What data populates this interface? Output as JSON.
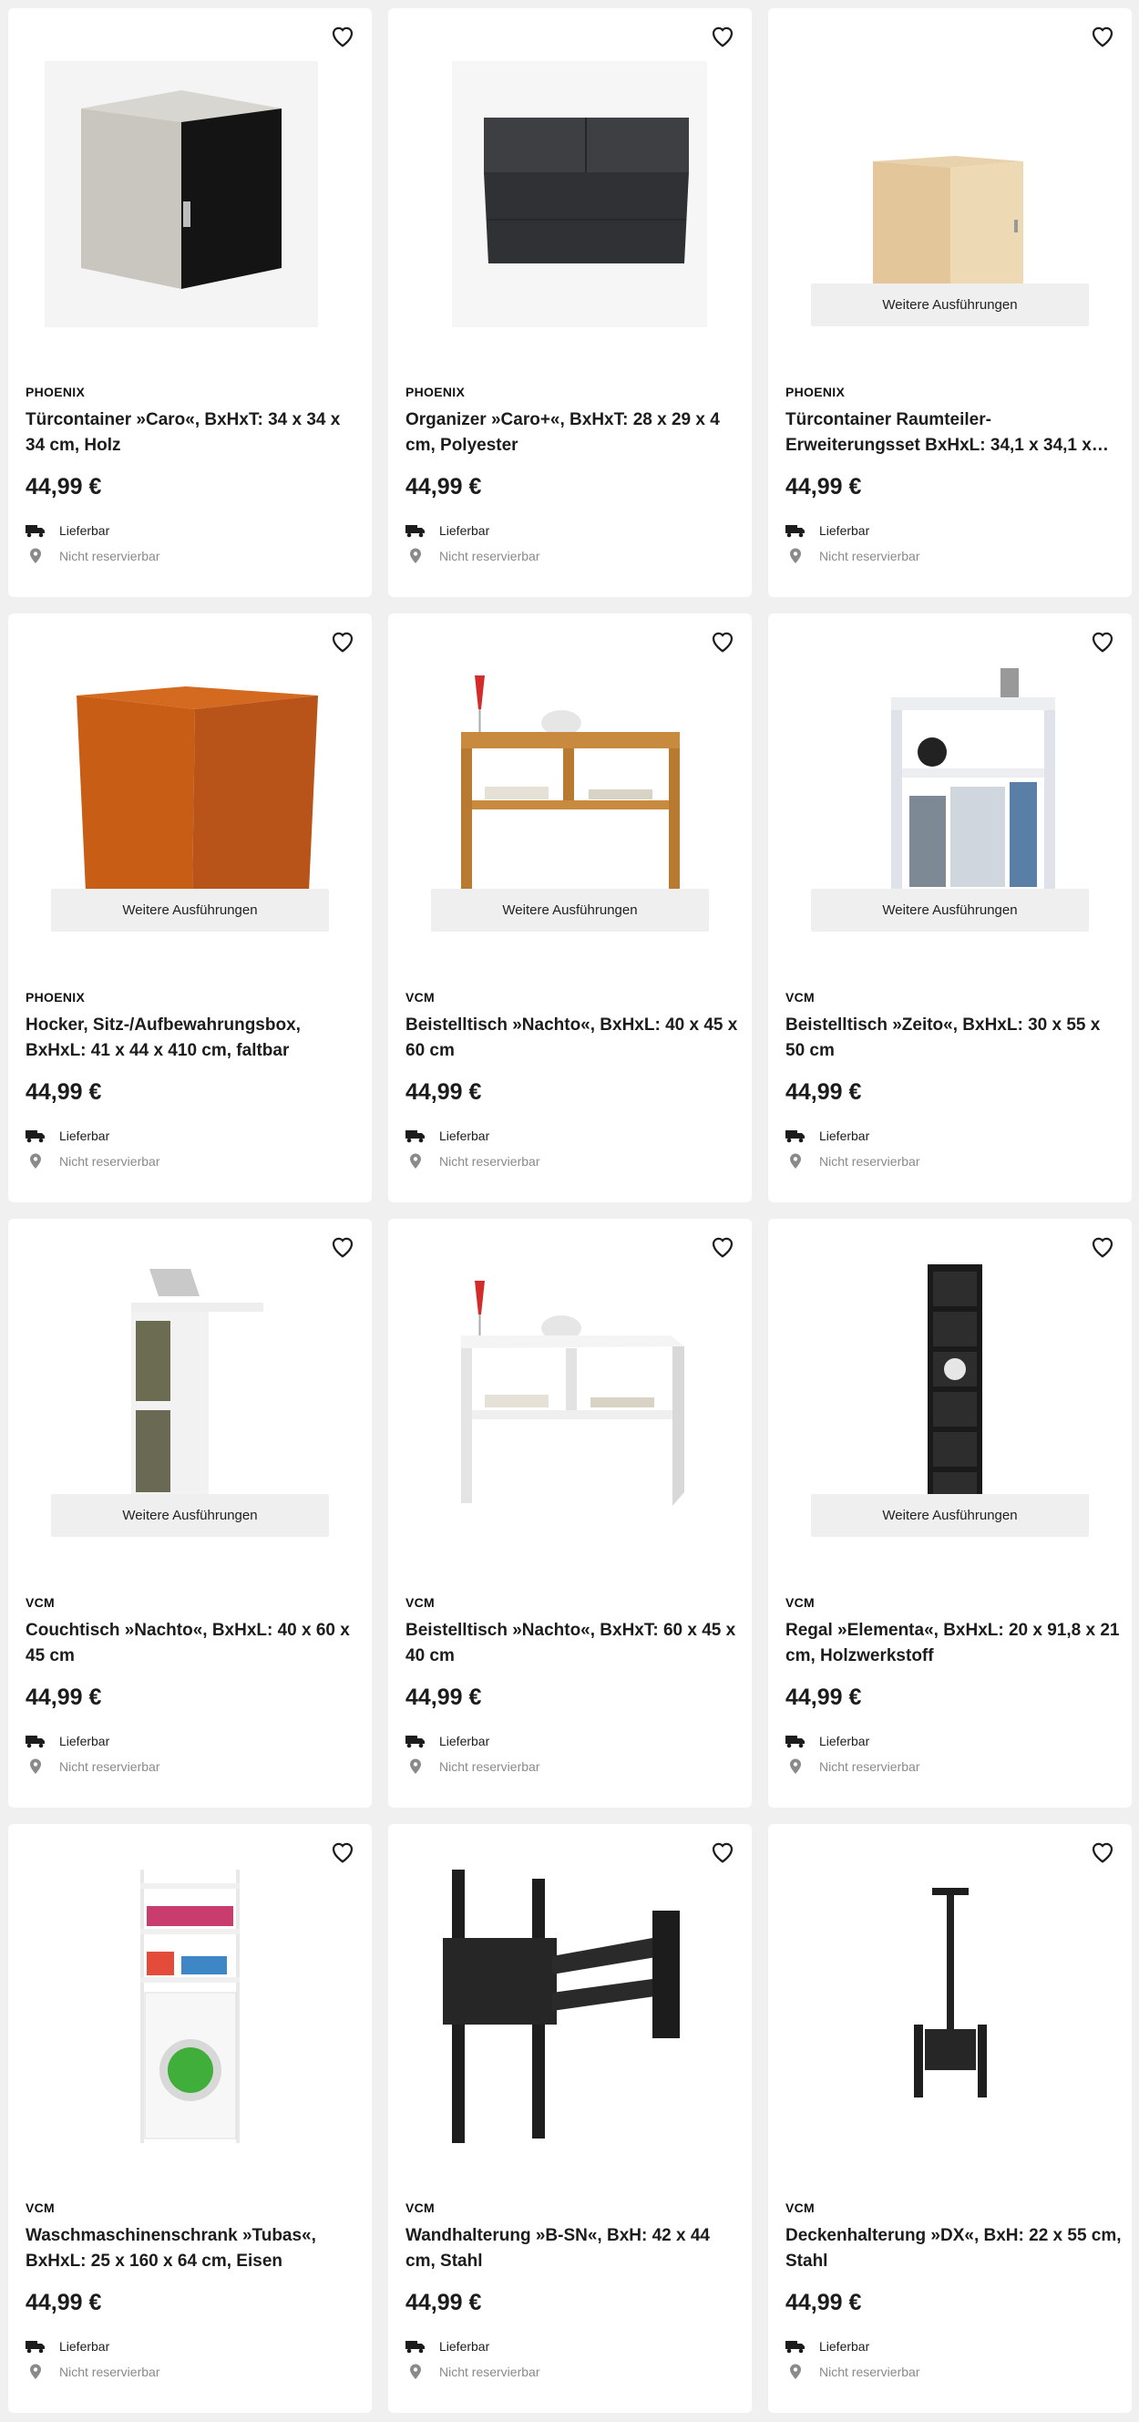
{
  "variant_label": "Weitere Ausführungen",
  "delivery_label": "Lieferbar",
  "reserve_label": "Nicht reservierbar",
  "products": [
    {
      "brand": "PHOENIX",
      "title": "Türcontainer »Caro«, BxHxT: 34 x 34 x 34 cm, Holz",
      "price": "44,99 €"
    },
    {
      "brand": "PHOENIX",
      "title": "Organizer »Caro+«, BxHxT: 28 x 29 x 4 cm, Polyester",
      "price": "44,99 €"
    },
    {
      "brand": "PHOENIX",
      "title": "Türcontainer Raumteiler-Erweiterungsset BxHxL: 34,1 x 34,1 x…",
      "price": "44,99 €"
    },
    {
      "brand": "PHOENIX",
      "title": "Hocker, Sitz-/Aufbewahrungsbox, BxHxL: 41 x 44 x 410 cm, faltbar",
      "price": "44,99 €"
    },
    {
      "brand": "VCM",
      "title": "Beistelltisch »Nachto«, BxHxL: 40 x 45 x 60 cm",
      "price": "44,99 €"
    },
    {
      "brand": "VCM",
      "title": "Beistelltisch »Zeito«, BxHxL: 30 x 55 x 50 cm",
      "price": "44,99 €"
    },
    {
      "brand": "VCM",
      "title": "Couchtisch »Nachto«, BxHxL: 40 x 60 x 45 cm",
      "price": "44,99 €"
    },
    {
      "brand": "VCM",
      "title": "Beistelltisch »Nachto«, BxHxT: 60 x 45 x 40 cm",
      "price": "44,99 €"
    },
    {
      "brand": "VCM",
      "title": "Regal »Elementa«, BxHxL: 20 x 91,8 x 21 cm, Holzwerkstoff",
      "price": "44,99 €"
    },
    {
      "brand": "VCM",
      "title": "Waschmaschinenschrank »Tubas«, BxHxL: 25 x 160 x 64 cm, Eisen",
      "price": "44,99 €"
    },
    {
      "brand": "VCM",
      "title": "Wandhalterung »B-SN«, BxH: 42 x 44 cm, Stahl",
      "price": "44,99 €"
    },
    {
      "brand": "VCM",
      "title": "Deckenhalterung »DX«, BxH: 22 x 55 cm, Stahl",
      "price": "44,99 €"
    }
  ]
}
